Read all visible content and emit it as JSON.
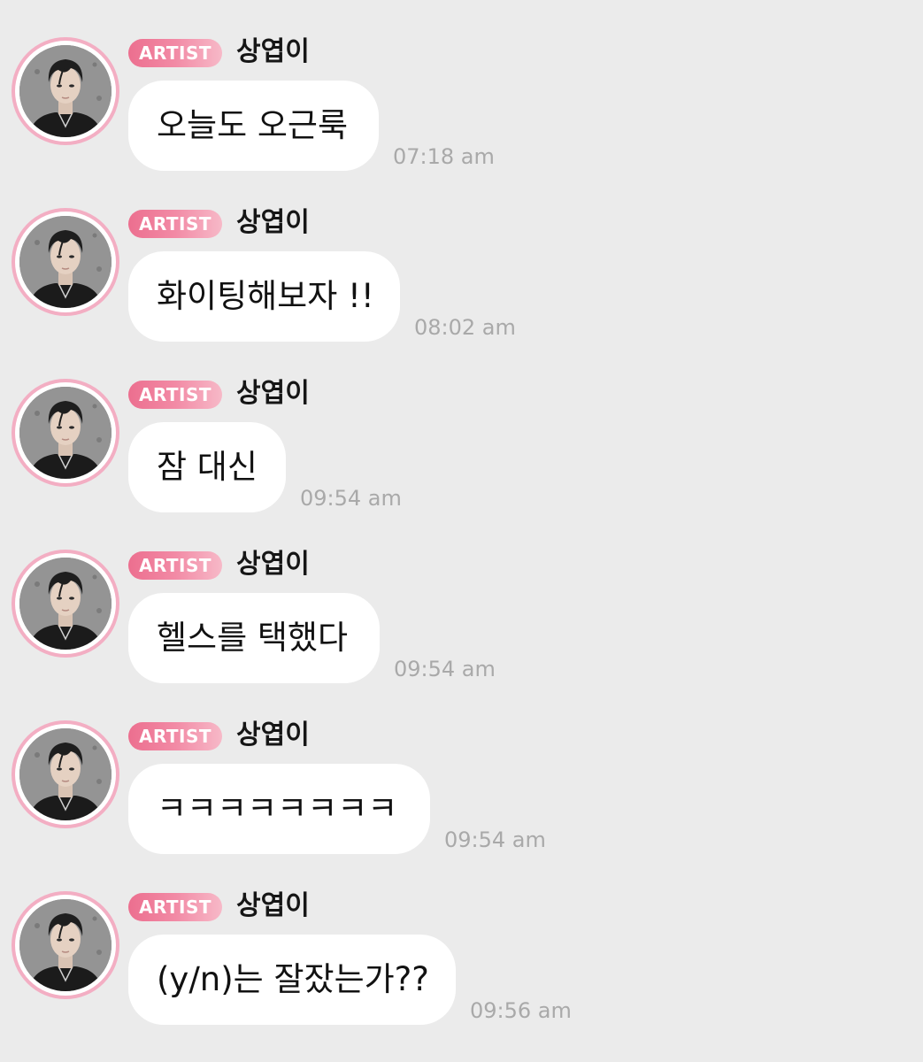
{
  "badge_label": "ARTIST",
  "avatar_icon": "profile-photo",
  "colors": {
    "background": "#ebebeb",
    "bubble": "#ffffff",
    "badge_start": "#ec6f8f",
    "badge_end": "#f7b9c8",
    "avatar_ring": "#f3aec3",
    "timestamp": "#a9a9a9"
  },
  "messages": [
    {
      "sender": "상엽이",
      "text": "오늘도 오근룩",
      "time": "07:18 am"
    },
    {
      "sender": "상엽이",
      "text": "화이팅해보자 !!",
      "time": "08:02 am"
    },
    {
      "sender": "상엽이",
      "text": "잠 대신",
      "time": "09:54 am"
    },
    {
      "sender": "상엽이",
      "text": "헬스를 택했다",
      "time": "09:54 am"
    },
    {
      "sender": "상엽이",
      "text": "ㅋㅋㅋㅋㅋㅋㅋㅋ",
      "time": "09:54 am"
    },
    {
      "sender": "상엽이",
      "text": "(y/n)는 잘잤는가??",
      "time": "09:56 am"
    }
  ]
}
